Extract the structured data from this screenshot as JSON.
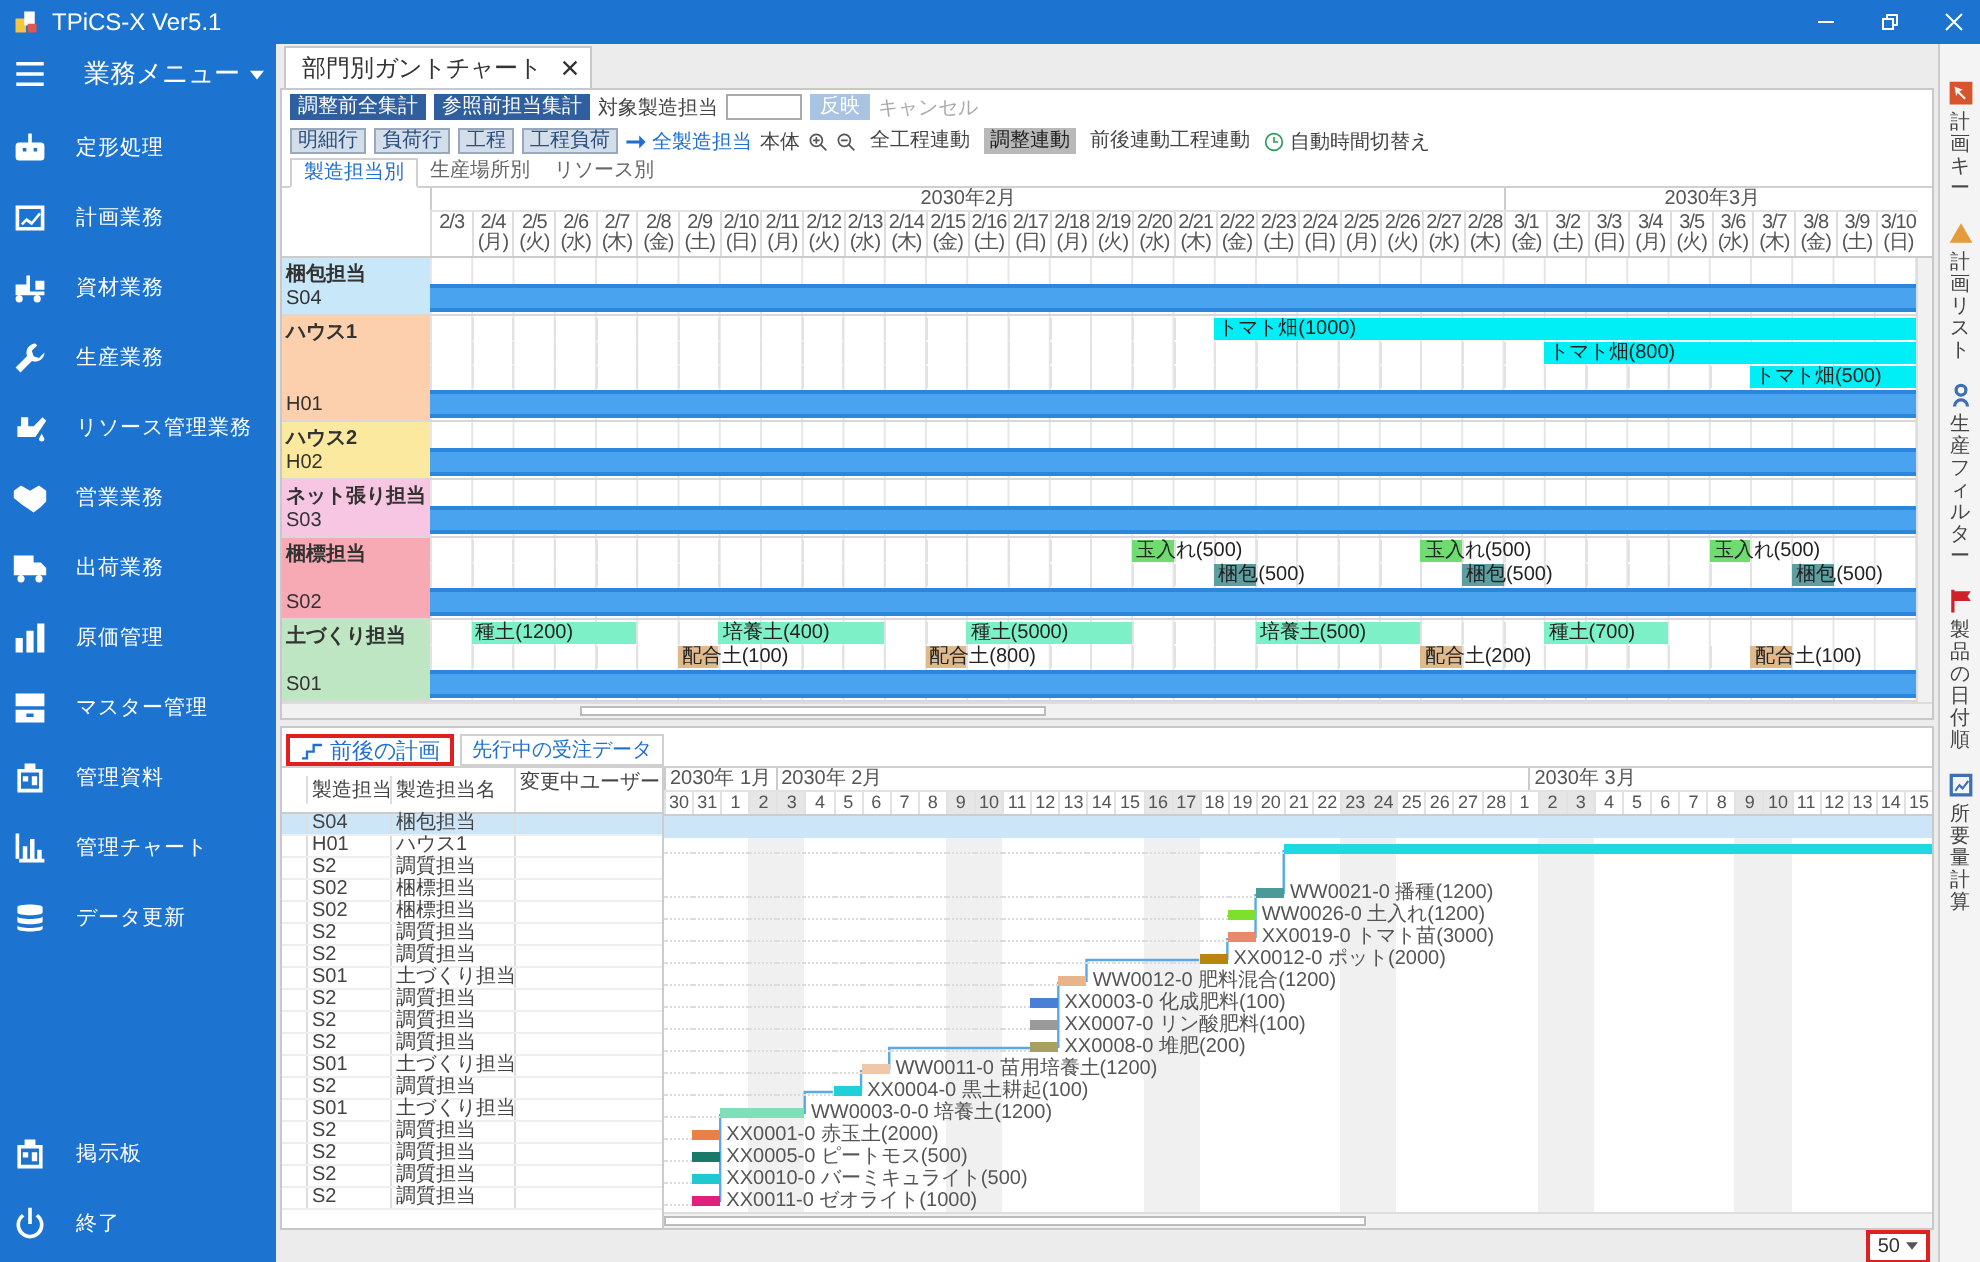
{
  "app": {
    "title": "TPiCS-X Ver5.1"
  },
  "menu": {
    "title": "業務メニュー",
    "items": [
      "定形処理",
      "計画業務",
      "資材業務",
      "生産業務",
      "リソース管理業務",
      "営業業務",
      "出荷業務",
      "原価管理",
      "マスター管理",
      "管理資料",
      "管理チャート",
      "データ更新"
    ],
    "bottom_items": [
      "掲示板",
      "終了"
    ]
  },
  "document_tab": {
    "title": "部門別ガントチャート"
  },
  "toolbar": {
    "actions": [
      {
        "kind": "primary",
        "label": "調整前全集計"
      },
      {
        "kind": "primary",
        "label": "参照前担当集計"
      },
      {
        "kind": "label",
        "label": "対象製造担当"
      },
      {
        "kind": "input"
      },
      {
        "kind": "disabled",
        "label": "反映"
      },
      {
        "kind": "muted",
        "label": "キャンセル"
      }
    ],
    "view_options": [
      {
        "kind": "chip",
        "label": "明細行",
        "selected": true
      },
      {
        "kind": "chip",
        "label": "負荷行",
        "selected": true
      },
      {
        "kind": "chip",
        "label": "工程",
        "selected": true
      },
      {
        "kind": "chip",
        "label": "工程負荷",
        "selected": true
      },
      {
        "kind": "link",
        "label": "全製造担当"
      },
      {
        "kind": "text",
        "label": "本体"
      },
      {
        "kind": "zoom-in"
      },
      {
        "kind": "zoom-out"
      },
      {
        "kind": "toggle",
        "label": "全工程連動",
        "selected": false
      },
      {
        "kind": "toggle",
        "label": "調整連動",
        "selected": true
      },
      {
        "kind": "toggle",
        "label": "前後連動工程連動",
        "selected": false
      },
      {
        "kind": "clock",
        "label": "自動時間切替え"
      }
    ]
  },
  "view_tabs": [
    {
      "label": "製造担当別",
      "selected": true
    },
    {
      "label": "生産場所別",
      "selected": false
    },
    {
      "label": "リソース別",
      "selected": false
    }
  ],
  "gantt": {
    "months": [
      {
        "label": "2030年2月",
        "days": [
          "2/3",
          "2/4 (月)",
          "2/5 (火)",
          "2/6 (水)",
          "2/7 (木)",
          "2/8 (金)",
          "2/9 (土)",
          "2/10 (日)",
          "2/11 (月)",
          "2/12 (火)",
          "2/13 (水)",
          "2/14 (木)",
          "2/15 (金)",
          "2/16 (土)",
          "2/17 (日)",
          "2/18 (月)",
          "2/19 (火)",
          "2/20 (水)",
          "2/21 (木)",
          "2/22 (金)",
          "2/23 (土)",
          "2/24 (日)",
          "2/25 (月)",
          "2/26 (火)",
          "2/27 (水)",
          "2/28 (木)"
        ]
      },
      {
        "label": "2030年3月",
        "days": [
          "3/1 (金)",
          "3/2 (土)",
          "3/3 (日)",
          "3/4 (月)",
          "3/5 (火)",
          "3/6 (水)",
          "3/7 (木)",
          "3/8 (金)",
          "3/9 (土)",
          "3/10 (日)"
        ]
      }
    ],
    "groups": [
      {
        "name": "梱包担当",
        "code": "S04",
        "color": "#c8e7f8"
      },
      {
        "name": "ハウス1",
        "code": "H01",
        "color": "#fdd0ad",
        "lanes": [
          {
            "color": "#00eef5",
            "cells": [
              {
                "busy": false
              },
              {
                "busy": false
              },
              {
                "busy": false
              },
              {
                "busy": false
              },
              {
                "busy": false
              },
              {
                "busy": false
              },
              {
                "busy": false
              },
              {
                "busy": false
              },
              {
                "busy": false
              },
              {
                "busy": false
              },
              {
                "busy": false
              },
              {
                "busy": false
              },
              {
                "busy": false
              },
              {
                "busy": false
              },
              {
                "busy": false
              },
              {
                "busy": false
              },
              {
                "busy": false
              },
              {
                "busy": false
              },
              {
                "busy": false
              },
              {
                "busy": true,
                "label": "トマト畑(1000)"
              },
              {
                "busy": true
              },
              {
                "busy": true
              },
              {
                "busy": true
              },
              {
                "busy": true
              },
              {
                "busy": true
              },
              {
                "busy": true
              },
              {
                "busy": true
              },
              {
                "busy": true
              },
              {
                "busy": true
              },
              {
                "busy": true
              },
              {
                "busy": true
              },
              {
                "busy": true
              },
              {
                "busy": true
              },
              {
                "busy": true
              },
              {
                "busy": true
              },
              {
                "busy": true
              }
            ]
          },
          {
            "color": "#00eef5",
            "cells": [
              {
                "busy": false
              },
              {
                "busy": false
              },
              {
                "busy": false
              },
              {
                "busy": false
              },
              {
                "busy": false
              },
              {
                "busy": false
              },
              {
                "busy": false
              },
              {
                "busy": false
              },
              {
                "busy": false
              },
              {
                "busy": false
              },
              {
                "busy": false
              },
              {
                "busy": false
              },
              {
                "busy": false
              },
              {
                "busy": false
              },
              {
                "busy": false
              },
              {
                "busy": false
              },
              {
                "busy": false
              },
              {
                "busy": false
              },
              {
                "busy": false
              },
              {
                "busy": false
              },
              {
                "busy": false
              },
              {
                "busy": false
              },
              {
                "busy": false
              },
              {
                "busy": false
              },
              {
                "busy": false
              },
              {
                "busy": false
              },
              {
                "busy": false
              },
              {
                "busy": true,
                "label": "トマト畑(800)"
              },
              {
                "busy": true
              },
              {
                "busy": true
              },
              {
                "busy": true
              },
              {
                "busy": true
              },
              {
                "busy": true
              },
              {
                "busy": true
              },
              {
                "busy": true
              },
              {
                "busy": true
              }
            ]
          },
          {
            "color": "#00eef5",
            "cells": [
              {
                "busy": false
              },
              {
                "busy": false
              },
              {
                "busy": false
              },
              {
                "busy": false
              },
              {
                "busy": false
              },
              {
                "busy": false
              },
              {
                "busy": false
              },
              {
                "busy": false
              },
              {
                "busy": false
              },
              {
                "busy": false
              },
              {
                "busy": false
              },
              {
                "busy": false
              },
              {
                "busy": false
              },
              {
                "busy": false
              },
              {
                "busy": false
              },
              {
                "busy": false
              },
              {
                "busy": false
              },
              {
                "busy": false
              },
              {
                "busy": false
              },
              {
                "busy": false
              },
              {
                "busy": false
              },
              {
                "busy": false
              },
              {
                "busy": false
              },
              {
                "busy": false
              },
              {
                "busy": false
              },
              {
                "busy": false
              },
              {
                "busy": false
              },
              {
                "busy": false
              },
              {
                "busy": false
              },
              {
                "busy": false
              },
              {
                "busy": false
              },
              {
                "busy": false
              },
              {
                "busy": true,
                "label": "トマト畑(500)"
              },
              {
                "busy": true
              },
              {
                "busy": true
              },
              {
                "busy": true
              }
            ]
          }
        ]
      },
      {
        "name": "ハウス2",
        "code": "H02",
        "color": "#fbe9a0"
      },
      {
        "name": "ネット張り担当",
        "code": "S03",
        "color": "#f6c6e2"
      },
      {
        "name": "梱標担当",
        "code": "S02",
        "color": "#f7a9b4",
        "lanes": [
          {
            "color": "#6fdc6f",
            "cells": [
              {
                "busy": false
              },
              {
                "busy": false
              },
              {
                "busy": false
              },
              {
                "busy": false
              },
              {
                "busy": false
              },
              {
                "busy": false
              },
              {
                "busy": false
              },
              {
                "busy": false
              },
              {
                "busy": false
              },
              {
                "busy": false
              },
              {
                "busy": false
              },
              {
                "busy": false
              },
              {
                "busy": false
              },
              {
                "busy": false
              },
              {
                "busy": false
              },
              {
                "busy": false
              },
              {
                "busy": false
              },
              {
                "busy": true,
                "label": "玉入れ(500)"
              },
              {
                "busy": false
              },
              {
                "busy": false
              },
              {
                "busy": false
              },
              {
                "busy": false
              },
              {
                "busy": false
              },
              {
                "busy": false
              },
              {
                "busy": true,
                "label": "玉入れ(500)"
              },
              {
                "busy": false
              },
              {
                "busy": false
              },
              {
                "busy": false
              },
              {
                "busy": false
              },
              {
                "busy": false
              },
              {
                "busy": false
              },
              {
                "busy": true,
                "label": "玉入れ(500)"
              }
            ]
          },
          {
            "color": "#5f9ea0",
            "cells": [
              {
                "busy": false
              },
              {
                "busy": false
              },
              {
                "busy": false
              },
              {
                "busy": false
              },
              {
                "busy": false
              },
              {
                "busy": false
              },
              {
                "busy": false
              },
              {
                "busy": false
              },
              {
                "busy": false
              },
              {
                "busy": false
              },
              {
                "busy": false
              },
              {
                "busy": false
              },
              {
                "busy": false
              },
              {
                "busy": false
              },
              {
                "busy": false
              },
              {
                "busy": false
              },
              {
                "busy": false
              },
              {
                "busy": false
              },
              {
                "busy": false
              },
              {
                "busy": true,
                "label": "梱包(500)"
              },
              {
                "busy": false
              },
              {
                "busy": false
              },
              {
                "busy": false
              },
              {
                "busy": false
              },
              {
                "busy": false
              },
              {
                "busy": true,
                "label": "梱包(500)"
              },
              {
                "busy": false
              },
              {
                "busy": false
              },
              {
                "busy": false
              },
              {
                "busy": false
              },
              {
                "busy": false
              },
              {
                "busy": false
              },
              {
                "busy": false
              },
              {
                "busy": true,
                "label": "梱包(500)"
              }
            ]
          }
        ]
      },
      {
        "name": "土づくり担当",
        "code": "S01",
        "color": "#bfe6c2",
        "lanes": [
          {
            "color": "#7ef0c8",
            "cells": [
              {
                "busy": false
              },
              {
                "busy": true,
                "label": "種土(1200)"
              },
              {
                "busy": true
              },
              {
                "busy": true
              },
              {
                "busy": true
              },
              {
                "busy": false
              },
              {
                "busy": false
              },
              {
                "busy": true,
                "label": "培養土(400)"
              },
              {
                "busy": true
              },
              {
                "busy": true
              },
              {
                "busy": true
              },
              {
                "busy": false
              },
              {
                "busy": false
              },
              {
                "busy": true,
                "label": "種土(5000)"
              },
              {
                "busy": true
              },
              {
                "busy": true
              },
              {
                "busy": true
              },
              {
                "busy": false
              },
              {
                "busy": false
              },
              {
                "busy": false
              },
              {
                "busy": true,
                "label": "培養土(500)"
              },
              {
                "busy": true
              },
              {
                "busy": true
              },
              {
                "busy": true
              },
              {
                "busy": false
              },
              {
                "busy": false
              },
              {
                "busy": false
              },
              {
                "busy": true,
                "label": "種土(700)"
              },
              {
                "busy": true
              },
              {
                "busy": true
              }
            ]
          },
          {
            "color": "#e0b98c",
            "cells": [
              {
                "busy": false
              },
              {
                "busy": false
              },
              {
                "busy": false
              },
              {
                "busy": false
              },
              {
                "busy": false
              },
              {
                "busy": false
              },
              {
                "busy": true,
                "label": "配合土(100)"
              },
              {
                "busy": false
              },
              {
                "busy": false
              },
              {
                "busy": false
              },
              {
                "busy": false
              },
              {
                "busy": false
              },
              {
                "busy": true,
                "label": "配合土(800)"
              },
              {
                "busy": false
              },
              {
                "busy": false
              },
              {
                "busy": false
              },
              {
                "busy": false
              },
              {
                "busy": false
              },
              {
                "busy": false
              },
              {
                "busy": false
              },
              {
                "busy": false
              },
              {
                "busy": false
              },
              {
                "busy": false
              },
              {
                "busy": false
              },
              {
                "busy": true,
                "label": "配合土(200)"
              },
              {
                "busy": false
              },
              {
                "busy": false
              },
              {
                "busy": false
              },
              {
                "busy": false
              },
              {
                "busy": false
              },
              {
                "busy": false
              },
              {
                "busy": false
              },
              {
                "busy": true,
                "label": "配合土(100)"
              }
            ]
          }
        ]
      }
    ]
  },
  "detail_tabs": [
    {
      "label": "前後の計画",
      "selected": true
    },
    {
      "label": "先行中の受注データ",
      "selected": false
    }
  ],
  "detail": {
    "columns": [
      "製造担当",
      "製造担当名",
      "変更中ユーザー"
    ],
    "months": [
      {
        "label": "2030年 1月",
        "days": [
          {
            "label": "30",
            "weekend": false
          },
          {
            "label": "31",
            "weekend": false
          }
        ]
      },
      {
        "label": "2030年 2月",
        "days": [
          {
            "label": "1",
            "weekend": false
          },
          {
            "label": "2",
            "weekend": true
          },
          {
            "label": "3",
            "weekend": true
          },
          {
            "label": "4",
            "weekend": false
          },
          {
            "label": "5",
            "weekend": false
          },
          {
            "label": "6",
            "weekend": false
          },
          {
            "label": "7",
            "weekend": false
          },
          {
            "label": "8",
            "weekend": false
          },
          {
            "label": "9",
            "weekend": true
          },
          {
            "label": "10",
            "weekend": true
          },
          {
            "label": "11",
            "weekend": false
          },
          {
            "label": "12",
            "weekend": false
          },
          {
            "label": "13",
            "weekend": false
          },
          {
            "label": "14",
            "weekend": false
          },
          {
            "label": "15",
            "weekend": false
          },
          {
            "label": "16",
            "weekend": true
          },
          {
            "label": "17",
            "weekend": true
          },
          {
            "label": "18",
            "weekend": false
          },
          {
            "label": "19",
            "weekend": false
          },
          {
            "label": "20",
            "weekend": false
          },
          {
            "label": "21",
            "weekend": false
          },
          {
            "label": "22",
            "weekend": false
          },
          {
            "label": "23",
            "weekend": true
          },
          {
            "label": "24",
            "weekend": true
          },
          {
            "label": "25",
            "weekend": false
          },
          {
            "label": "26",
            "weekend": false
          },
          {
            "label": "27",
            "weekend": false
          },
          {
            "label": "28",
            "weekend": false
          }
        ]
      },
      {
        "label": "2030年 3月",
        "days": [
          {
            "label": "1",
            "weekend": false
          },
          {
            "label": "2",
            "weekend": true
          },
          {
            "label": "3",
            "weekend": true
          },
          {
            "label": "4",
            "weekend": false
          },
          {
            "label": "5",
            "weekend": false
          },
          {
            "label": "6",
            "weekend": false
          },
          {
            "label": "7",
            "weekend": false
          },
          {
            "label": "8",
            "weekend": false
          },
          {
            "label": "9",
            "weekend": true
          },
          {
            "label": "10",
            "weekend": true
          },
          {
            "label": "11",
            "weekend": false
          },
          {
            "label": "12",
            "weekend": false
          },
          {
            "label": "13",
            "weekend": false
          },
          {
            "label": "14",
            "weekend": false
          },
          {
            "label": "15",
            "weekend": false
          }
        ]
      }
    ],
    "rows": [
      {
        "code": "S04",
        "name": "梱包担当",
        "selected": true
      },
      {
        "code": "H01",
        "name": "ハウス1",
        "selected": false,
        "color": "#20d8e0",
        "cells": [
          {
            "busy": false
          },
          {
            "busy": false
          },
          {
            "busy": false
          },
          {
            "busy": false
          },
          {
            "busy": false
          },
          {
            "busy": false
          },
          {
            "busy": false
          },
          {
            "busy": false
          },
          {
            "busy": false
          },
          {
            "busy": false
          },
          {
            "busy": false
          },
          {
            "busy": false
          },
          {
            "busy": false
          },
          {
            "busy": false
          },
          {
            "busy": false
          },
          {
            "busy": false
          },
          {
            "busy": false
          },
          {
            "busy": false
          },
          {
            "busy": false
          },
          {
            "busy": false
          },
          {
            "busy": false
          },
          {
            "busy": false
          },
          {
            "busy": true
          },
          {
            "busy": true
          },
          {
            "busy": true
          },
          {
            "busy": true
          },
          {
            "busy": true
          },
          {
            "busy": true
          },
          {
            "busy": true
          },
          {
            "busy": true
          },
          {
            "busy": true
          },
          {
            "busy": true
          },
          {
            "busy": true
          },
          {
            "busy": true
          },
          {
            "busy": true
          },
          {
            "busy": true
          },
          {
            "busy": true
          },
          {
            "busy": true
          },
          {
            "busy": true
          },
          {
            "busy": true
          },
          {
            "busy": true
          },
          {
            "busy": true
          },
          {
            "busy": true
          },
          {
            "busy": true
          },
          {
            "busy": true
          }
        ]
      },
      {
        "code": "S2",
        "name": "調質担当",
        "selected": false
      },
      {
        "code": "S02",
        "name": "梱標担当",
        "selected": false,
        "color": "#4a9a9a",
        "cells": [
          {
            "busy": false
          },
          {
            "busy": false
          },
          {
            "busy": false
          },
          {
            "busy": false
          },
          {
            "busy": false
          },
          {
            "busy": false
          },
          {
            "busy": false
          },
          {
            "busy": false
          },
          {
            "busy": false
          },
          {
            "busy": false
          },
          {
            "busy": false
          },
          {
            "busy": false
          },
          {
            "busy": false
          },
          {
            "busy": false
          },
          {
            "busy": false
          },
          {
            "busy": false
          },
          {
            "busy": false
          },
          {
            "busy": false
          },
          {
            "busy": false
          },
          {
            "busy": false
          },
          {
            "busy": false
          },
          {
            "busy": true,
            "label": "WW0021-0 播種(1200)"
          }
        ]
      },
      {
        "code": "S02",
        "name": "梱標担当",
        "selected": false,
        "color": "#7ee02a",
        "cells": [
          {
            "busy": false
          },
          {
            "busy": false
          },
          {
            "busy": false
          },
          {
            "busy": false
          },
          {
            "busy": false
          },
          {
            "busy": false
          },
          {
            "busy": false
          },
          {
            "busy": false
          },
          {
            "busy": false
          },
          {
            "busy": false
          },
          {
            "busy": false
          },
          {
            "busy": false
          },
          {
            "busy": false
          },
          {
            "busy": false
          },
          {
            "busy": false
          },
          {
            "busy": false
          },
          {
            "busy": false
          },
          {
            "busy": false
          },
          {
            "busy": false
          },
          {
            "busy": false
          },
          {
            "busy": true,
            "label": "WW0026-0 土入れ(1200)"
          }
        ]
      },
      {
        "code": "S2",
        "name": "調質担当",
        "selected": false,
        "color": "#e8896a",
        "cells": [
          {
            "busy": false
          },
          {
            "busy": false
          },
          {
            "busy": false
          },
          {
            "busy": false
          },
          {
            "busy": false
          },
          {
            "busy": false
          },
          {
            "busy": false
          },
          {
            "busy": false
          },
          {
            "busy": false
          },
          {
            "busy": false
          },
          {
            "busy": false
          },
          {
            "busy": false
          },
          {
            "busy": false
          },
          {
            "busy": false
          },
          {
            "busy": false
          },
          {
            "busy": false
          },
          {
            "busy": false
          },
          {
            "busy": false
          },
          {
            "busy": false
          },
          {
            "busy": false
          },
          {
            "busy": true,
            "label": "XX0019-0 トマト苗(3000)"
          }
        ]
      },
      {
        "code": "S2",
        "name": "調質担当",
        "selected": false,
        "color": "#b8860b",
        "cells": [
          {
            "busy": false
          },
          {
            "busy": false
          },
          {
            "busy": false
          },
          {
            "busy": false
          },
          {
            "busy": false
          },
          {
            "busy": false
          },
          {
            "busy": false
          },
          {
            "busy": false
          },
          {
            "busy": false
          },
          {
            "busy": false
          },
          {
            "busy": false
          },
          {
            "busy": false
          },
          {
            "busy": false
          },
          {
            "busy": false
          },
          {
            "busy": false
          },
          {
            "busy": false
          },
          {
            "busy": false
          },
          {
            "busy": false
          },
          {
            "busy": false
          },
          {
            "busy": true,
            "label": "XX0012-0 ポット(2000)"
          }
        ]
      },
      {
        "code": "S01",
        "name": "土づくり担当",
        "selected": false,
        "color": "#e8b48a",
        "cells": [
          {
            "busy": false
          },
          {
            "busy": false
          },
          {
            "busy": false
          },
          {
            "busy": false
          },
          {
            "busy": false
          },
          {
            "busy": false
          },
          {
            "busy": false
          },
          {
            "busy": false
          },
          {
            "busy": false
          },
          {
            "busy": false
          },
          {
            "busy": false
          },
          {
            "busy": false
          },
          {
            "busy": false
          },
          {
            "busy": false
          },
          {
            "busy": true,
            "label": "WW0012-0 肥料混合(1200)"
          }
        ]
      },
      {
        "code": "S2",
        "name": "調質担当",
        "selected": false,
        "color": "#4a7fd8",
        "cells": [
          {
            "busy": false
          },
          {
            "busy": false
          },
          {
            "busy": false
          },
          {
            "busy": false
          },
          {
            "busy": false
          },
          {
            "busy": false
          },
          {
            "busy": false
          },
          {
            "busy": false
          },
          {
            "busy": false
          },
          {
            "busy": false
          },
          {
            "busy": false
          },
          {
            "busy": false
          },
          {
            "busy": false
          },
          {
            "busy": true,
            "label": "XX0003-0 化成肥料(100)"
          }
        ]
      },
      {
        "code": "S2",
        "name": "調質担当",
        "selected": false,
        "color": "#9a9a9a",
        "cells": [
          {
            "busy": false
          },
          {
            "busy": false
          },
          {
            "busy": false
          },
          {
            "busy": false
          },
          {
            "busy": false
          },
          {
            "busy": false
          },
          {
            "busy": false
          },
          {
            "busy": false
          },
          {
            "busy": false
          },
          {
            "busy": false
          },
          {
            "busy": false
          },
          {
            "busy": false
          },
          {
            "busy": false
          },
          {
            "busy": true,
            "label": "XX0007-0 リン酸肥料(100)"
          }
        ]
      },
      {
        "code": "S2",
        "name": "調質担当",
        "selected": false,
        "color": "#a8a060",
        "cells": [
          {
            "busy": false
          },
          {
            "busy": false
          },
          {
            "busy": false
          },
          {
            "busy": false
          },
          {
            "busy": false
          },
          {
            "busy": false
          },
          {
            "busy": false
          },
          {
            "busy": false
          },
          {
            "busy": false
          },
          {
            "busy": false
          },
          {
            "busy": false
          },
          {
            "busy": false
          },
          {
            "busy": false
          },
          {
            "busy": true,
            "label": "XX0008-0 堆肥(200)"
          }
        ]
      },
      {
        "code": "S01",
        "name": "土づくり担当",
        "selected": false,
        "color": "#f0c8a8",
        "cells": [
          {
            "busy": false
          },
          {
            "busy": false
          },
          {
            "busy": false
          },
          {
            "busy": false
          },
          {
            "busy": false
          },
          {
            "busy": false
          },
          {
            "busy": false
          },
          {
            "busy": true,
            "label": "WW0011-0 苗用培養土(1200)"
          }
        ]
      },
      {
        "code": "S2",
        "name": "調質担当",
        "selected": false,
        "color": "#20d0d8",
        "cells": [
          {
            "busy": false
          },
          {
            "busy": false
          },
          {
            "busy": false
          },
          {
            "busy": false
          },
          {
            "busy": false
          },
          {
            "busy": false
          },
          {
            "busy": true,
            "label": "XX0004-0 黒土耕起(100)"
          }
        ]
      },
      {
        "code": "S01",
        "name": "土づくり担当",
        "selected": false,
        "color": "#7ee0b8",
        "cells": [
          {
            "busy": false
          },
          {
            "busy": false
          },
          {
            "busy": true,
            "label": "WW0003-0-0 培養土(1200)"
          },
          {
            "busy": true
          },
          {
            "busy": true
          }
        ]
      },
      {
        "code": "S2",
        "name": "調質担当",
        "selected": false,
        "color": "#e8804a",
        "cells": [
          {
            "busy": false
          },
          {
            "busy": true,
            "label": "XX0001-0 赤玉土(2000)"
          }
        ]
      },
      {
        "code": "S2",
        "name": "調質担当",
        "selected": false,
        "color": "#1a7a6a",
        "cells": [
          {
            "busy": false
          },
          {
            "busy": true,
            "label": "XX0005-0 ピートモス(500)"
          }
        ]
      },
      {
        "code": "S2",
        "name": "調質担当",
        "selected": false,
        "color": "#20c8d0",
        "cells": [
          {
            "busy": false
          },
          {
            "busy": true,
            "label": "XX0010-0 バーミキュライト(500)"
          }
        ]
      },
      {
        "code": "S2",
        "name": "調質担当",
        "selected": false,
        "color": "#e0207a",
        "cells": [
          {
            "busy": false
          },
          {
            "busy": true,
            "label": "XX0011-0 ゼオライト(1000)"
          }
        ]
      }
    ]
  },
  "side_tools": [
    "計画キー",
    "計画リスト",
    "生産フィルター",
    "製品の日付順",
    "所要量計算"
  ],
  "status_bar": {
    "page_size": "50"
  }
}
